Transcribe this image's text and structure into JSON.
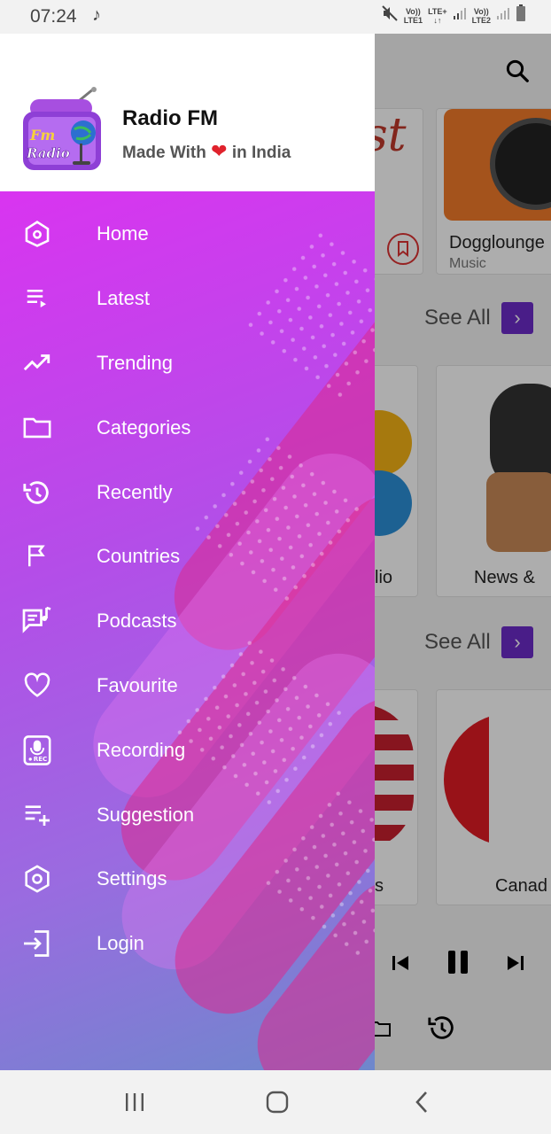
{
  "status": {
    "time": "07:24",
    "net1": [
      "Vo))",
      "LTE1"
    ],
    "net1b": "LTE+",
    "net2": [
      "Vo))",
      "LTE2"
    ]
  },
  "drawer": {
    "app_name": "Radio FM",
    "tagline_prefix": "Made With",
    "tagline_suffix": "in India",
    "logo_text_top": "Fm",
    "logo_text_bottom": "Radio",
    "menu": [
      {
        "label": "Home",
        "icon": "home-icon"
      },
      {
        "label": "Latest",
        "icon": "playlist-icon"
      },
      {
        "label": "Trending",
        "icon": "trending-icon"
      },
      {
        "label": "Categories",
        "icon": "folder-icon"
      },
      {
        "label": "Recently",
        "icon": "history-icon"
      },
      {
        "label": "Countries",
        "icon": "flag-icon"
      },
      {
        "label": "Podcasts",
        "icon": "podcast-icon"
      },
      {
        "label": "Favourite",
        "icon": "heart-icon"
      },
      {
        "label": "Recording",
        "icon": "mic-rec-icon"
      },
      {
        "label": "Suggestion",
        "icon": "playlist-add-icon"
      },
      {
        "label": "Settings",
        "icon": "settings-icon"
      },
      {
        "label": "Login",
        "icon": "login-icon"
      }
    ],
    "recording_badge": "REC"
  },
  "background": {
    "cards_row1": [
      {
        "partial_text": "st"
      },
      {
        "title": "Dogglounge",
        "subtitle": "Music"
      }
    ],
    "see_all": "See All",
    "cards_row2": [
      {
        "title": "lio"
      },
      {
        "title": "News &"
      }
    ],
    "cards_row3": [
      {
        "title": "s"
      },
      {
        "title": "Canad"
      }
    ]
  },
  "colors": {
    "drawer_gradient_start": "#d934f0",
    "drawer_gradient_end": "#6e88cc",
    "accent": "#6c2cc9",
    "heart": "#e0222c"
  }
}
